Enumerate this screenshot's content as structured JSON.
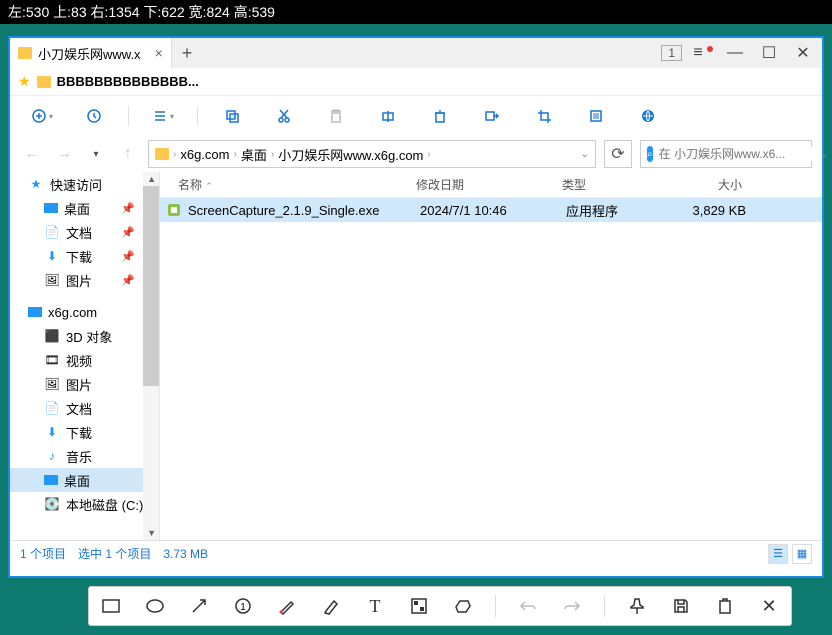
{
  "coords": "左:530  上:83  右:1354  下:622  宽:824  高:539",
  "tab_title": "小刀娱乐网www.x",
  "tab_badge": "1",
  "bookmark": "BBBBBBBBBBBBBB...",
  "breadcrumb": {
    "p1": "x6g.com",
    "p2": "桌面",
    "p3": "小刀娱乐网www.x6g.com"
  },
  "search_placeholder": "在 小刀娱乐网www.x6...",
  "columns": {
    "name": "名称",
    "date": "修改日期",
    "type": "类型",
    "size": "大小"
  },
  "sidebar": {
    "quick": "快速访问",
    "desktop": "桌面",
    "docs": "文档",
    "downloads": "下载",
    "pictures": "图片",
    "pc": "x6g.com",
    "obj3d": "3D 对象",
    "videos": "视频",
    "pictures2": "图片",
    "docs2": "文档",
    "downloads2": "下载",
    "music": "音乐",
    "desktop2": "桌面",
    "disk_c": "本地磁盘 (C:)"
  },
  "file": {
    "name": "ScreenCapture_2.1.9_Single.exe",
    "date": "2024/7/1 10:46",
    "type": "应用程序",
    "size": "3,829 KB"
  },
  "status": {
    "items": "1 个项目",
    "selected": "选中 1 个项目",
    "size": "3.73 MB"
  }
}
